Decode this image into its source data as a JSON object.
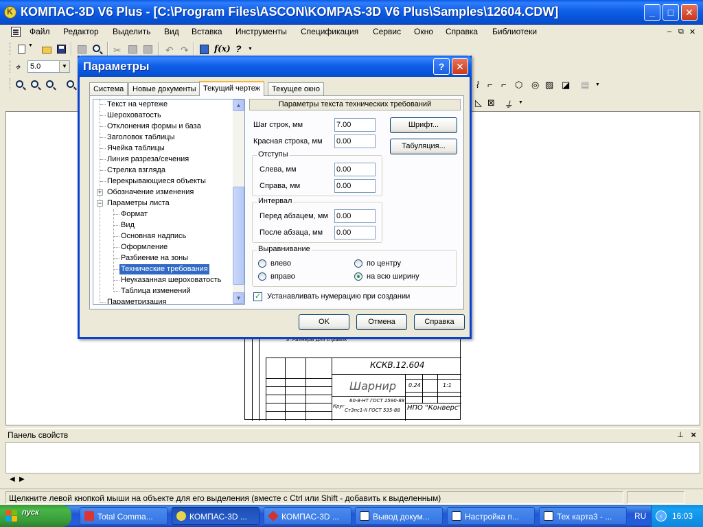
{
  "app": {
    "title": "КОМПАС-3D V6 Plus - [C:\\Program Files\\ASCON\\KOMPAS-3D V6 Plus\\Samples\\12604.CDW]"
  },
  "menu": {
    "items": [
      {
        "label": "Файл"
      },
      {
        "label": "Редактор"
      },
      {
        "label": "Выделить"
      },
      {
        "label": "Вид"
      },
      {
        "label": "Вставка"
      },
      {
        "label": "Инструменты"
      },
      {
        "label": "Спецификация"
      },
      {
        "label": "Сервис"
      },
      {
        "label": "Окно"
      },
      {
        "label": "Справка"
      },
      {
        "label": "Библиотеки"
      }
    ]
  },
  "toolbar": {
    "step_value": "5.0",
    "fx_label": "f(x)",
    "help_label": "?"
  },
  "dialog": {
    "title": "Параметры",
    "tabs": [
      {
        "label": "Система"
      },
      {
        "label": "Новые документы"
      },
      {
        "label": "Текущий чертеж"
      },
      {
        "label": "Текущее окно"
      }
    ],
    "tree": [
      {
        "label": "Текст на чертеже"
      },
      {
        "label": "Шероховатость"
      },
      {
        "label": "Отклонения формы и база"
      },
      {
        "label": "Заголовок таблицы"
      },
      {
        "label": "Ячейка таблицы"
      },
      {
        "label": "Линия разреза/сечения"
      },
      {
        "label": "Стрелка взгляда"
      },
      {
        "label": "Перекрывающиеся объекты"
      },
      {
        "label": "Обозначение изменения"
      },
      {
        "label": "Параметры листа"
      },
      {
        "label": "Формат"
      },
      {
        "label": "Вид"
      },
      {
        "label": "Основная надпись"
      },
      {
        "label": "Оформление"
      },
      {
        "label": "Разбиение на зоны"
      },
      {
        "label": "Технические требования"
      },
      {
        "label": "Неуказанная шероховатость"
      },
      {
        "label": "Таблица изменений"
      },
      {
        "label": "Параметризация"
      }
    ],
    "section_header": "Параметры текста технических требований",
    "line_step": {
      "label": "Шаг строк, мм",
      "value": "7.00"
    },
    "indent_first": {
      "label": "Красная строка, мм",
      "value": "0.00"
    },
    "indents": {
      "title": "Отступы",
      "left": {
        "label": "Слева, мм",
        "value": "0.00"
      },
      "right": {
        "label": "Справа, мм",
        "value": "0.00"
      }
    },
    "interval": {
      "title": "Интервал",
      "before": {
        "label": "Перед абзацем, мм",
        "value": "0.00"
      },
      "after": {
        "label": "После абзаца, мм",
        "value": "0.00"
      }
    },
    "alignment": {
      "title": "Выравнивание",
      "left": "влево",
      "center": "по центру",
      "right": "вправо",
      "justify": "на всю ширину"
    },
    "numbering_checkbox": "Устанавливать нумерацию при создании",
    "font_button": "Шрифт...",
    "tab_button": "Табуляция...",
    "ok_button": "OK",
    "cancel_button": "Отмена",
    "help_button": "Справка"
  },
  "sheet": {
    "designation": "КСКВ.12.604",
    "name": "Шарнир",
    "material_1": "60-8-НТ ГОСТ 2590-88",
    "material_2": "Ст3пс1-II ГОСТ 535-88",
    "material_prefix": "Круг",
    "org": "НПО \"Конверс\"",
    "mass": "0.24",
    "scale": "1:1",
    "note": "3. Размеры для справок"
  },
  "props_panel": {
    "title": "Панель свойств"
  },
  "status": {
    "message": "Щелкните левой кнопкой мыши на объекте для его выделения (вместе с Ctrl или Shift - добавить к выделенным)"
  },
  "taskbar": {
    "start": "пуск",
    "tasks": [
      {
        "label": "Total Comma..."
      },
      {
        "label": "КОМПАС-3D ..."
      },
      {
        "label": "КОМПАС-3D ..."
      },
      {
        "label": "Вывод докум..."
      },
      {
        "label": "Настройка п..."
      },
      {
        "label": "Тех карта3 - ..."
      }
    ],
    "lang": "RU",
    "clock": "16:03"
  }
}
